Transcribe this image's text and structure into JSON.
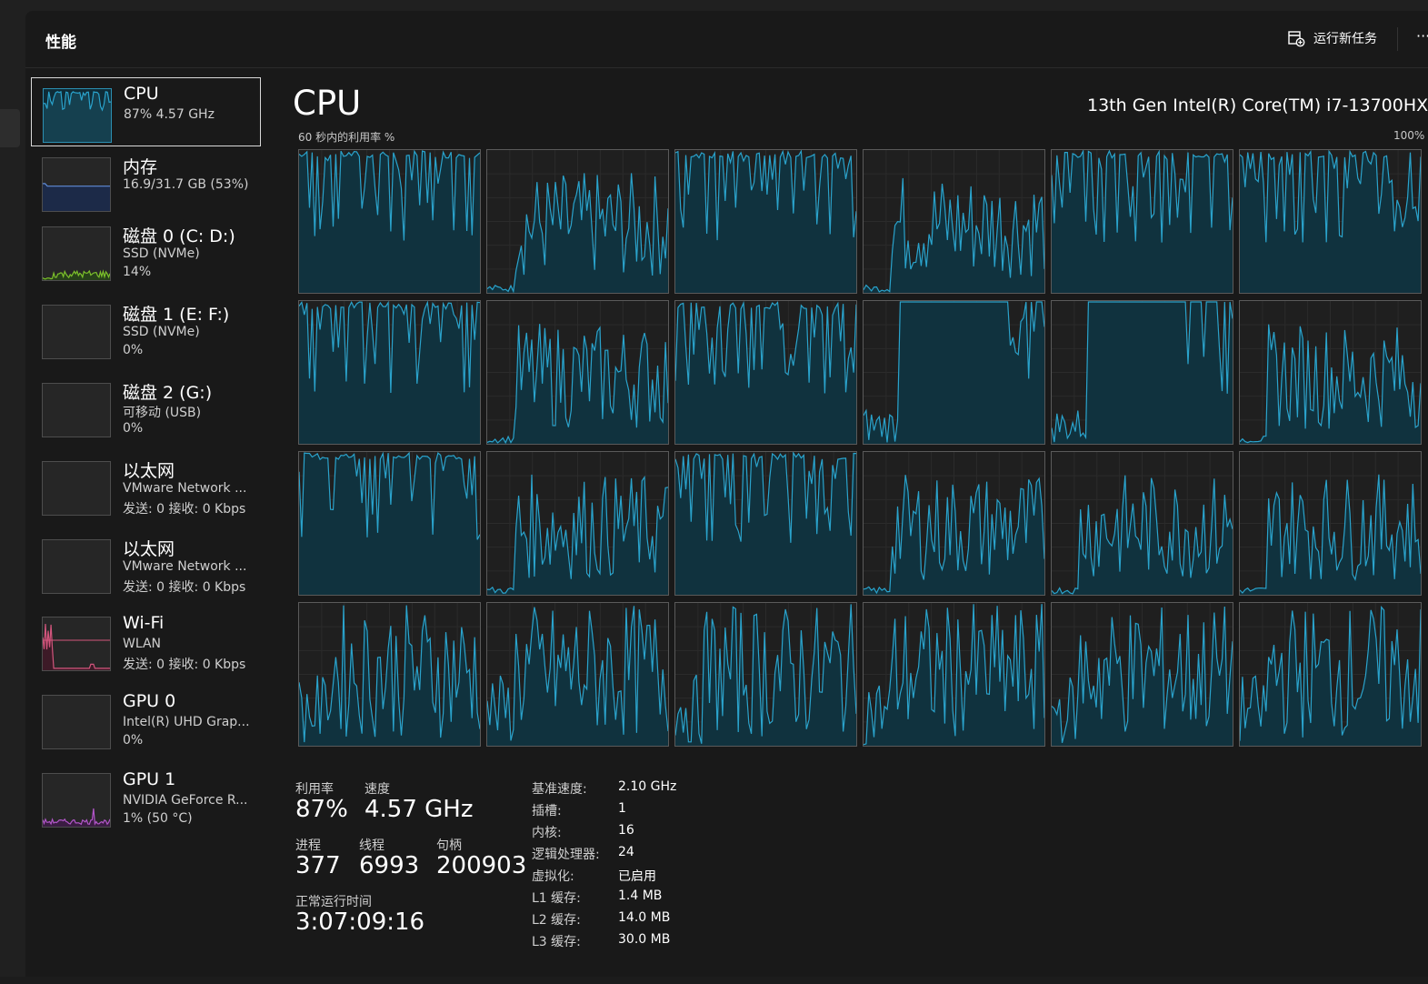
{
  "header": {
    "title": "性能",
    "run_task_label": "运行新任务",
    "more_label": "···"
  },
  "sidebar": {
    "items": [
      {
        "title": "CPU",
        "line1": "87%  4.57 GHz",
        "line2": ""
      },
      {
        "title": "内存",
        "line1": "16.9/31.7 GB (53%)",
        "line2": ""
      },
      {
        "title": "磁盘 0 (C: D:)",
        "line1": "SSD (NVMe)",
        "line2": "14%"
      },
      {
        "title": "磁盘 1 (E: F:)",
        "line1": "SSD (NVMe)",
        "line2": "0%"
      },
      {
        "title": "磁盘 2 (G:)",
        "line1": "可移动 (USB)",
        "line2": "0%"
      },
      {
        "title": "以太网",
        "line1": "VMware Network ...",
        "line2": "发送: 0 接收: 0 Kbps"
      },
      {
        "title": "以太网",
        "line1": "VMware Network ...",
        "line2": "发送: 0 接收: 0 Kbps"
      },
      {
        "title": "Wi-Fi",
        "line1": "WLAN",
        "line2": "发送: 0 接收: 0 Kbps"
      },
      {
        "title": "GPU 0",
        "line1": "Intel(R) UHD Grap...",
        "line2": "0%"
      },
      {
        "title": "GPU 1",
        "line1": "NVIDIA GeForce R...",
        "line2": "1% (50 °C)"
      }
    ]
  },
  "main": {
    "title": "CPU",
    "model": "13th Gen Intel(R) Core(TM) i7-13700HX",
    "graph_caption": "60 秒内的利用率 %",
    "graph_max": "100%"
  },
  "stats": {
    "utilization_label": "利用率",
    "utilization": "87%",
    "speed_label": "速度",
    "speed": "4.57 GHz",
    "processes_label": "进程",
    "processes": "377",
    "threads_label": "线程",
    "threads": "6993",
    "handles_label": "句柄",
    "handles": "200903",
    "uptime_label": "正常运行时间",
    "uptime": "3:07:09:16"
  },
  "info": [
    {
      "label": "基准速度:",
      "value": "2.10 GHz"
    },
    {
      "label": "插槽:",
      "value": "1"
    },
    {
      "label": "内核:",
      "value": "16"
    },
    {
      "label": "逻辑处理器:",
      "value": "24"
    },
    {
      "label": "虚拟化:",
      "value": "已启用"
    },
    {
      "label": "L1 缓存:",
      "value": "1.4 MB"
    },
    {
      "label": "L2 缓存:",
      "value": "14.0 MB"
    },
    {
      "label": "L3 缓存:",
      "value": "30.0 MB"
    }
  ],
  "colors": {
    "cpu_line": "#2aa3cc",
    "cpu_fill": "#10323e",
    "memory_line": "#5f8bd6",
    "disk_line": "#7cc12a",
    "wifi_line": "#d2557c",
    "gpu_line": "#b256c9"
  },
  "logical_processor_profile": [
    "s",
    "l",
    "s",
    "l",
    "s",
    "s",
    "s",
    "l",
    "s",
    "f",
    "f",
    "l",
    "s",
    "l",
    "s",
    "l",
    "l",
    "l",
    "m",
    "m",
    "m",
    "m",
    "m",
    "m"
  ]
}
